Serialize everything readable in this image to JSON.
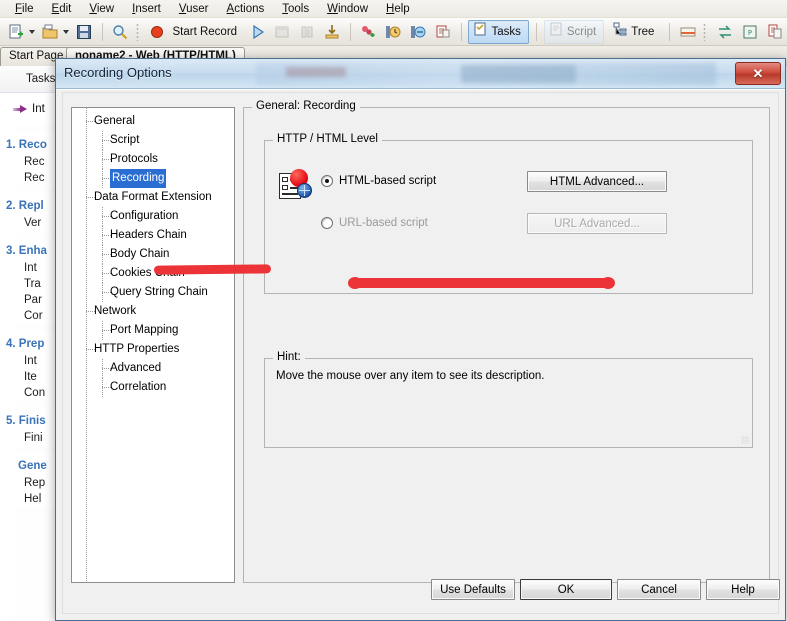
{
  "app": {
    "menubar": [
      "File",
      "Edit",
      "View",
      "Insert",
      "Vuser",
      "Actions",
      "Tools",
      "Window",
      "Help"
    ],
    "toolbar": {
      "start_record_label": "Start Record",
      "tasks_label": "Tasks",
      "script_label": "Script",
      "tree_label": "Tree",
      "icons": [
        "new-script-icon",
        "open-script-icon",
        "save-icon",
        "zoom-icon",
        "record-icon",
        "run-icon",
        "stop-icon",
        "pause-icon",
        "download-icon",
        "add-param-icon",
        "runtime-settings-icon",
        "runtime-viewer-icon",
        "snapshot-icon",
        "tasks-icon",
        "script-icon",
        "tree-icon",
        "output-icon",
        "compare-icon",
        "parameter-list-icon",
        "copy-icon"
      ]
    },
    "tabs": [
      {
        "label": "Start Page",
        "active": false
      },
      {
        "label": "noname2 - Web (HTTP/HTML)",
        "active": true
      }
    ],
    "taskpane": {
      "header": "Tasks",
      "intro": "Int",
      "groups": [
        {
          "title": "1. Reco",
          "items": [
            "Rec",
            "Rec"
          ]
        },
        {
          "title": "2. Repl",
          "items": [
            "Ver"
          ]
        },
        {
          "title": "3. Enha",
          "items": [
            "Int",
            "Tra",
            "Par",
            "Cor"
          ]
        },
        {
          "title": "4. Prep",
          "items": [
            "Int",
            "Ite",
            "Con"
          ]
        },
        {
          "title": "5. Finis",
          "items": [
            "Fini"
          ]
        },
        {
          "title": "Gene",
          "items": [
            "Rep",
            "Hel"
          ]
        }
      ]
    }
  },
  "dialog": {
    "title": "Recording Options",
    "close_label": "✕",
    "tree": [
      {
        "label": "General",
        "level": 0,
        "selected": false
      },
      {
        "label": "Script",
        "level": 1,
        "selected": false
      },
      {
        "label": "Protocols",
        "level": 1,
        "selected": false
      },
      {
        "label": "Recording",
        "level": 1,
        "selected": true
      },
      {
        "label": "Data Format Extension",
        "level": 0,
        "selected": false
      },
      {
        "label": "Configuration",
        "level": 1,
        "selected": false
      },
      {
        "label": "Headers Chain",
        "level": 1,
        "selected": false
      },
      {
        "label": "Body Chain",
        "level": 1,
        "selected": false
      },
      {
        "label": "Cookies Chain",
        "level": 1,
        "selected": false
      },
      {
        "label": "Query String Chain",
        "level": 1,
        "selected": false
      },
      {
        "label": "Network",
        "level": 0,
        "selected": false
      },
      {
        "label": "Port Mapping",
        "level": 1,
        "selected": false
      },
      {
        "label": "HTTP Properties",
        "level": 0,
        "selected": false
      },
      {
        "label": "Advanced",
        "level": 1,
        "selected": false
      },
      {
        "label": "Correlation",
        "level": 1,
        "selected": false
      }
    ],
    "panel": {
      "caption": "General: Recording",
      "http_group_caption": "HTTP / HTML Level",
      "options": [
        {
          "label": "HTML-based script",
          "selected": true,
          "button": "HTML Advanced...",
          "button_enabled": true
        },
        {
          "label": "URL-based script",
          "selected": false,
          "button": "URL Advanced...",
          "button_enabled": false
        }
      ],
      "hint_caption": "Hint:",
      "hint_text": "Move the mouse over any item to see its description."
    },
    "buttons": [
      {
        "label": "Use Defaults",
        "default": false
      },
      {
        "label": "OK",
        "default": true
      },
      {
        "label": "Cancel",
        "default": false
      },
      {
        "label": "Help",
        "default": false
      }
    ]
  },
  "annotations": {
    "marker_color": "#ec3337",
    "marks": [
      "strikethrough-over-data-format-extension",
      "underline-below-html-based-script"
    ]
  }
}
